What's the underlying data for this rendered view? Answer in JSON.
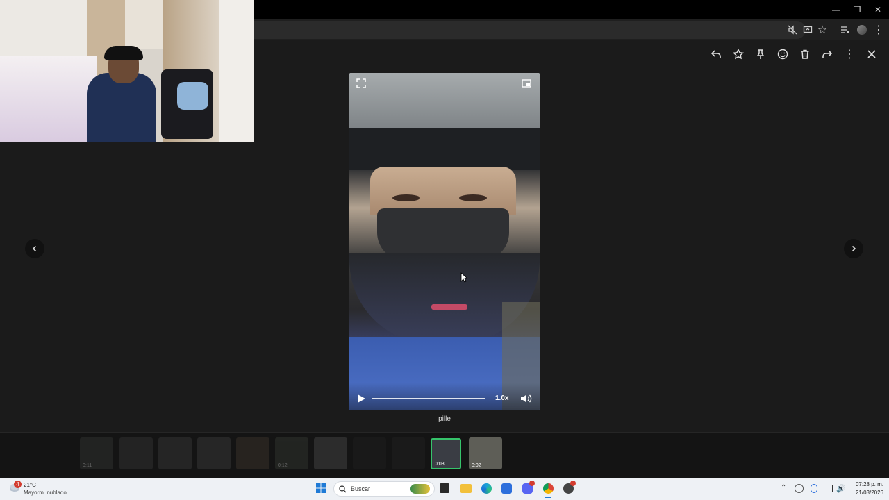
{
  "viewer": {
    "caption": "pille",
    "video": {
      "speed": "1.0x",
      "progress": 0.0
    },
    "thumbnails": [
      {
        "duration": "0:11",
        "selected": false
      },
      {
        "duration": "",
        "selected": false
      },
      {
        "duration": "",
        "selected": false
      },
      {
        "duration": "",
        "selected": false
      },
      {
        "duration": "",
        "selected": false
      },
      {
        "duration": "0:12",
        "selected": false
      },
      {
        "duration": "",
        "selected": false
      },
      {
        "duration": "",
        "selected": false
      },
      {
        "duration": "",
        "selected": false
      },
      {
        "duration": "0:03",
        "selected": true
      },
      {
        "duration": "0:02",
        "selected": false
      }
    ]
  },
  "taskbar": {
    "weather_badge": "4",
    "temperature": "21°C",
    "condition": "Mayorm. nublado",
    "search_placeholder": "Buscar",
    "time": "07:28 p. m.",
    "date": "21/03/2026"
  },
  "colors": {
    "selected_thumb": "#36c46b",
    "viewer_bg": "#1b1b1b"
  }
}
